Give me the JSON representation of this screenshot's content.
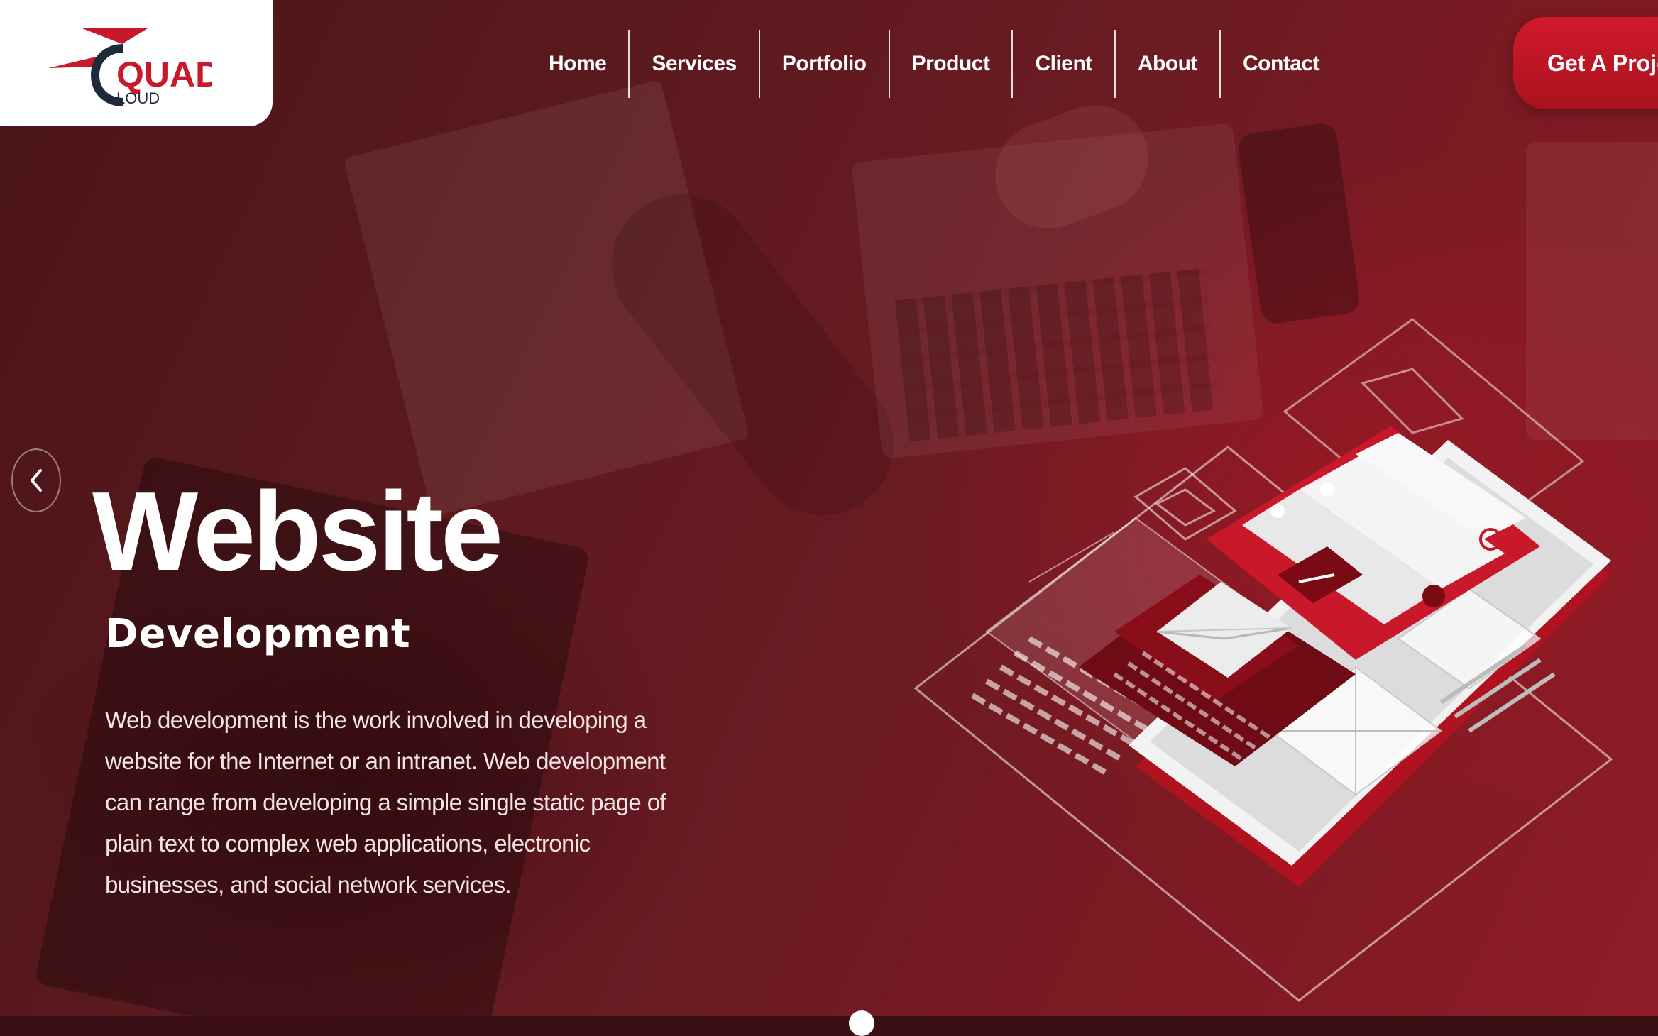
{
  "logo": {
    "text_main": "QUAD",
    "text_sub": "LOUD",
    "icon": "quad-cloud-logo"
  },
  "nav": {
    "items": [
      {
        "label": "Home"
      },
      {
        "label": "Services"
      },
      {
        "label": "Portfolio"
      },
      {
        "label": "Product"
      },
      {
        "label": "Client"
      },
      {
        "label": "About"
      },
      {
        "label": "Contact"
      }
    ]
  },
  "cta": {
    "label": "Get A Project"
  },
  "slider": {
    "prev_icon": "chevron-left-icon"
  },
  "hero": {
    "title": "Website",
    "subtitle": "Development",
    "description": "Web development is the work involved in developing a website for the Internet or an intranet. Web development can range from developing a simple single static page of plain text to complex web applications, electronic businesses, and social network services."
  },
  "colors": {
    "brand_red": "#c8182a",
    "logo_dark": "#1e2a3a",
    "text_white": "#ffffff"
  }
}
